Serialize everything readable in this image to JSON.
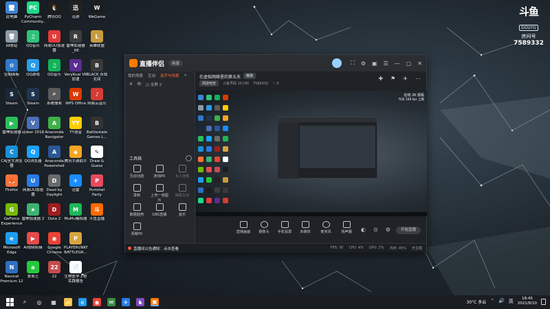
{
  "desktop": {
    "icons": [
      {
        "label": "此电脑",
        "color": "#3b83d6",
        "glyph": "🖥",
        "col": 0,
        "row": 0
      },
      {
        "label": "回收站",
        "color": "#8c9aa8",
        "glyph": "🗑",
        "col": 0,
        "row": 1
      },
      {
        "label": "控制面板",
        "color": "#2f79c9",
        "glyph": "⚙",
        "col": 0,
        "row": 2
      },
      {
        "label": "Steam",
        "color": "#1b2838",
        "glyph": "S",
        "col": 0,
        "row": 3
      },
      {
        "label": "雷神加速器",
        "color": "#2bbd5c",
        "glyph": "▶",
        "col": 0,
        "row": 4
      },
      {
        "label": "CAJ全文浏览器",
        "color": "#1a8fd8",
        "glyph": "C",
        "col": 0,
        "row": 5
      },
      {
        "label": "Firefox",
        "color": "#ff7139",
        "glyph": "🦊",
        "col": 0,
        "row": 6
      },
      {
        "label": "GeForce Experience",
        "color": "#76b900",
        "glyph": "G",
        "col": 0,
        "row": 7
      },
      {
        "label": "Microsoft Edge",
        "color": "#1f9cf0",
        "glyph": "e",
        "col": 0,
        "row": 8
      },
      {
        "label": "Navicat Premium 12",
        "color": "#2e6fbf",
        "glyph": "N",
        "col": 0,
        "row": 9
      },
      {
        "label": "PyCharm Community...",
        "color": "#21d789",
        "glyph": "PC",
        "col": 1,
        "row": 0
      },
      {
        "label": "QQ音乐",
        "color": "#31c27c",
        "glyph": "♫",
        "col": 1,
        "row": 1
      },
      {
        "label": "QQ游戏",
        "color": "#2a9de8",
        "glyph": "Q",
        "col": 1,
        "row": 2
      },
      {
        "label": "Steam",
        "color": "#20354d",
        "glyph": "S",
        "col": 1,
        "row": 3
      },
      {
        "label": "vJoker 2016",
        "color": "#4a6fb5",
        "glyph": "V",
        "col": 1,
        "row": 4
      },
      {
        "label": "QQ浏览器",
        "color": "#1aa2ff",
        "glyph": "Q",
        "col": 1,
        "row": 5
      },
      {
        "label": "网易UU加速器",
        "color": "#2a7be4",
        "glyph": "U",
        "col": 1,
        "row": 6
      },
      {
        "label": "雷神加速器 2",
        "color": "#3cb371",
        "glyph": "★",
        "col": 1,
        "row": 7
      },
      {
        "label": "Ai视频剪辑",
        "color": "#e54b4b",
        "glyph": "▶",
        "col": 1,
        "row": 8
      },
      {
        "label": "爱奇艺",
        "color": "#25c93d",
        "glyph": "a",
        "col": 1,
        "row": 9
      },
      {
        "label": "腾讯QQ",
        "color": "#1e1e1e",
        "glyph": "🐧",
        "col": 2,
        "row": 0
      },
      {
        "label": "网易UU加速器",
        "color": "#e23b3b",
        "glyph": "U",
        "col": 2,
        "row": 1
      },
      {
        "label": "QQ音乐",
        "color": "#11b359",
        "glyph": "♫",
        "col": 2,
        "row": 2
      },
      {
        "label": "系统搜索",
        "color": "#5a5a5a",
        "glyph": "⌕",
        "col": 2,
        "row": 3
      },
      {
        "label": "Anaconda Navigator",
        "color": "#3eb049",
        "glyph": "A",
        "col": 2,
        "row": 4
      },
      {
        "label": "Anaconda Powershell",
        "color": "#2b5797",
        "glyph": "A",
        "col": 2,
        "row": 5
      },
      {
        "label": "Dead by Daylight",
        "color": "#6a6a6a",
        "glyph": "D",
        "col": 2,
        "row": 6
      },
      {
        "label": "Dota 2",
        "color": "#a11d1d",
        "glyph": "D",
        "col": 2,
        "row": 7
      },
      {
        "label": "Google Chrome",
        "color": "#ea4335",
        "glyph": "◉",
        "col": 2,
        "row": 8
      },
      {
        "label": "22",
        "color": "#c44d4d",
        "glyph": "22",
        "col": 2,
        "row": 9
      },
      {
        "label": "迅游",
        "color": "#222",
        "glyph": "迅",
        "col": 3,
        "row": 0
      },
      {
        "label": "雷神加速器 _RE",
        "color": "#3d3d3d",
        "glyph": "R",
        "col": 3,
        "row": 1
      },
      {
        "label": "VeryKuai VK 加速",
        "color": "#5c2c91",
        "glyph": "V",
        "col": 3,
        "row": 2
      },
      {
        "label": "WPS Office",
        "color": "#d83b01",
        "glyph": "W",
        "col": 3,
        "row": 3
      },
      {
        "label": "YY语音",
        "color": "#ffcc00",
        "glyph": "YY",
        "col": 3,
        "row": 4
      },
      {
        "label": "腾讯手游助手",
        "color": "#f5a623",
        "glyph": "◆",
        "col": 3,
        "row": 5
      },
      {
        "label": "迅雷",
        "color": "#1a8cff",
        "glyph": "✈",
        "col": 3,
        "row": 6
      },
      {
        "label": "MuMu模拟器",
        "color": "#1fb65c",
        "glyph": "M",
        "col": 3,
        "row": 7
      },
      {
        "label": "PLAYERUNKNOWN'S BATTLEGR...",
        "color": "#d9a441",
        "glyph": "P",
        "col": 3,
        "row": 8
      },
      {
        "label": "生物医学工程实践报告",
        "color": "#ffffff",
        "glyph": "📄",
        "col": 3,
        "row": 9
      },
      {
        "label": "WeGame",
        "color": "#1d1d1d",
        "glyph": "W",
        "col": 4,
        "row": 0
      },
      {
        "label": "英雄联盟",
        "color": "#c89b3c",
        "glyph": "L",
        "col": 4,
        "row": 1
      },
      {
        "label": "BLACK 永劫无间",
        "color": "#3a3a3a",
        "glyph": "B",
        "col": 4,
        "row": 2
      },
      {
        "label": "网易云音乐",
        "color": "#d43c33",
        "glyph": "♪",
        "col": 4,
        "row": 3
      },
      {
        "label": "Battlestate Games L...",
        "color": "#333",
        "glyph": "B",
        "col": 4,
        "row": 4
      },
      {
        "label": "Draw & Guess",
        "color": "#ffffff",
        "glyph": "✎",
        "col": 4,
        "row": 5
      },
      {
        "label": "Pummel Party",
        "color": "#e84a5f",
        "glyph": "P",
        "col": 4,
        "row": 6
      },
      {
        "label": "斗鱼直播",
        "color": "#ff6a00",
        "glyph": "斗",
        "col": 4,
        "row": 7
      }
    ]
  },
  "room_badge": {
    "logo": "斗鱼",
    "sub": "DOUYU",
    "label": "房间号",
    "number": "7589332"
  },
  "app": {
    "name": "直播伴侣",
    "version": "新版",
    "title_icons": [
      "⛶",
      "⚙",
      "▣",
      "☰",
      "—",
      "▢",
      "✕"
    ],
    "left_tabs": [
      "我的场景",
      "互动",
      "选手与场景",
      "+"
    ],
    "left_active_tab": 2,
    "scene_row": [
      "⚙",
      "👁",
      "◫ 全屏 2"
    ],
    "tools_title": "工具箱",
    "tools": [
      {
        "label": "互动功能",
        "dim": false
      },
      {
        "label": "连线PK",
        "dim": false
      },
      {
        "label": "多人连麦",
        "dim": true
      },
      {
        "label": "录制",
        "dim": false
      },
      {
        "label": "上传一张图片",
        "dim": false
      },
      {
        "label": "弹幕互动",
        "dim": true
      },
      {
        "label": "数据趋势",
        "dim": false
      },
      {
        "label": "OBS直播",
        "dim": false
      },
      {
        "label": "音乐",
        "dim": false
      },
      {
        "label": "贡献PK",
        "dim": false
      }
    ],
    "stream_title": "在虚拟网络里的第五天",
    "modify": "修改",
    "category": "网游竞技",
    "meta": [
      "斗鱼号码 15小时",
      "7589332",
      "♡ 0"
    ],
    "preview_tools": [
      "✚",
      "⚑",
      "✈",
      "⋯"
    ],
    "preview_badge_line1": "在线 2K 观看",
    "preview_badge_line2": "今日 100 fps 上限",
    "bottom_tools": [
      {
        "label": "直播画面",
        "shape": "square"
      },
      {
        "label": "摄像头",
        "shape": "round"
      },
      {
        "label": "手机投屏",
        "shape": "square"
      },
      {
        "label": "多媒体",
        "shape": "square"
      },
      {
        "label": "麦克风",
        "shape": "round"
      },
      {
        "label": "扬声器",
        "shape": "square"
      }
    ],
    "bottom_icons": [
      "◐",
      "⊙",
      "⚙"
    ],
    "start_live": "开始直播",
    "notice": "直播间公告通知：点击查看",
    "stats": [
      "FPS: 30",
      "CPU: 4%",
      "GPU: 2%",
      "内存: 45%",
      "无主题"
    ]
  },
  "taskbar": {
    "items": [
      {
        "glyph": "⌕",
        "color": "#1a1d22"
      },
      {
        "glyph": "◎",
        "color": "#1a1d22"
      },
      {
        "glyph": "▦",
        "color": "#1a1d22"
      },
      {
        "glyph": "📁",
        "color": "#f2c14e"
      },
      {
        "glyph": "e",
        "color": "#1f9cf0"
      },
      {
        "glyph": "◉",
        "color": "#ea4335"
      },
      {
        "glyph": "✉",
        "color": "#3b8d46"
      },
      {
        "glyph": "✈",
        "color": "#2a7be4"
      },
      {
        "glyph": "♞",
        "color": "#7d4bbf"
      },
      {
        "glyph": "▣",
        "color": "#ff7a00"
      }
    ],
    "weather": "30°C 多云",
    "tray_icons": [
      "⌃",
      "🔊",
      "英"
    ],
    "time": "18:45",
    "date": "2021/8/10"
  }
}
